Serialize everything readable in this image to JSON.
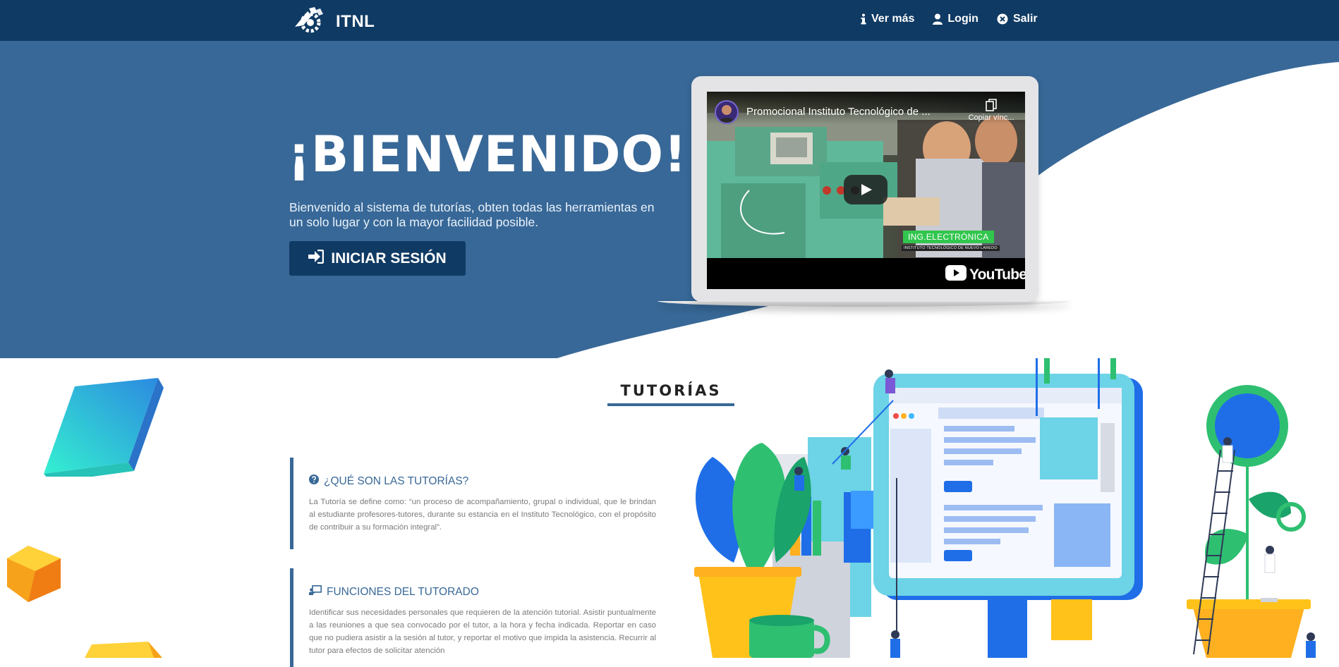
{
  "navbar": {
    "brand": "ITNL",
    "links": [
      {
        "label": "Ver más",
        "icon": "info-icon"
      },
      {
        "label": "Login",
        "icon": "user-icon"
      },
      {
        "label": "Salir",
        "icon": "close-circle-icon"
      }
    ]
  },
  "hero": {
    "title": "¡BIENVENIDO!",
    "subtitle": "Bienvenido al sistema de tutorías, obten todas las herramientas en un solo lugar y con la mayor facilidad posible.",
    "button_label": "INICIAR SESIÓN",
    "button_icon": "sign-in-icon"
  },
  "video": {
    "title": "Promocional Instituto Tecnológico de ...",
    "copy_label": "Copiar vínc...",
    "tag": "ING.ELECTRÓNICA",
    "institution": "INSTITUTO TECNOLÓGICO DE NUEVO LAREDO",
    "platform": "YouTube"
  },
  "section": {
    "title": "TUTORÍAS",
    "cards": [
      {
        "icon": "question-circle-icon",
        "title": "¿QUÉ SON LAS TUTORÍAS?",
        "text": "La Tutoría se define como: “un proceso de acompañamiento, grupal o individual, que le brindan al estudiante profesores-tutores, durante su estancia en el Instituto Tecnológico, con el propósito de contribuir a su formación integral”."
      },
      {
        "icon": "chalkboard-user-icon",
        "title": "FUNCIONES DEL TUTORADO",
        "text": "Identificar sus necesidades personales que requieren de la atención tutorial. Asistir puntualmente a las reuniones a que sea convocado por el tutor, a la hora y fecha indicada. Reportar en caso que no pudiera asistir a la sesión al tutor, y reportar el motivo que impida la asistencia. Recurrir al tutor para efectos de solicitar atención"
      }
    ]
  },
  "colors": {
    "navbar": "#0f3a63",
    "hero": "#386897",
    "accent": "#386897",
    "button": "#0f3a63"
  }
}
